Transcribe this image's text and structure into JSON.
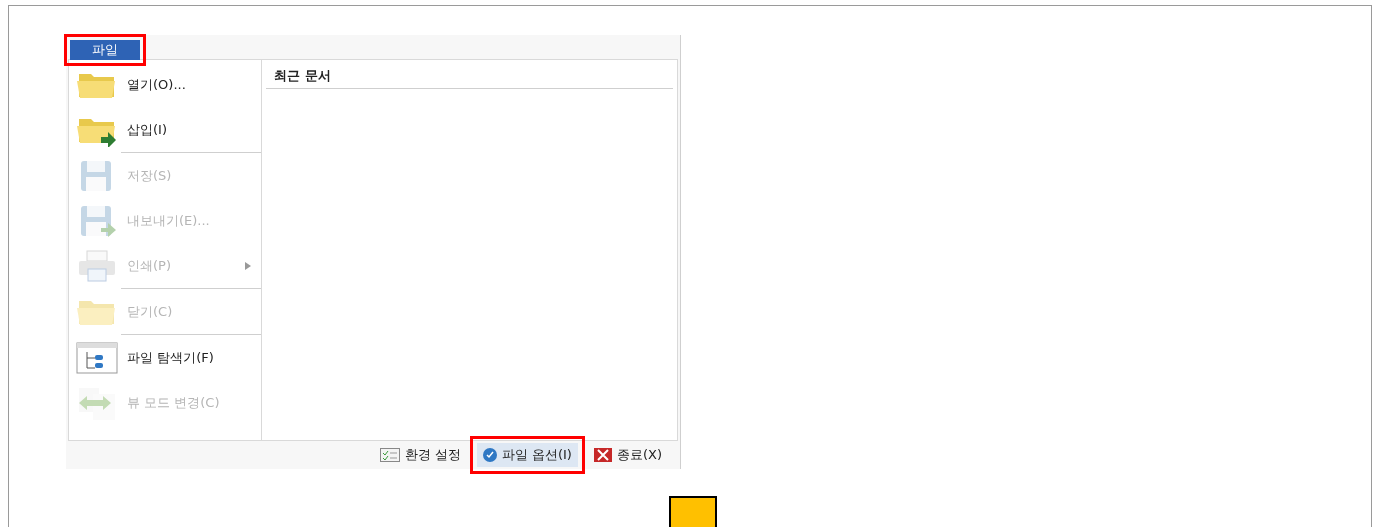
{
  "menu_tab": {
    "label": "파일",
    "highlighted": true
  },
  "menu_items": [
    {
      "label": "열기(O)...",
      "kind": "folder",
      "disabled": false,
      "separator_after": false,
      "submenu": false
    },
    {
      "label": "삽입(I)",
      "kind": "folder-insert",
      "disabled": false,
      "separator_after": true,
      "submenu": false
    },
    {
      "label": "저장(S)",
      "kind": "disk",
      "disabled": true,
      "separator_after": false,
      "submenu": false
    },
    {
      "label": "내보내기(E)...",
      "kind": "disk-export",
      "disabled": true,
      "separator_after": false,
      "submenu": false
    },
    {
      "label": "인쇄(P)",
      "kind": "printer",
      "disabled": true,
      "separator_after": true,
      "submenu": true
    },
    {
      "label": "닫기(C)",
      "kind": "folder-plain",
      "disabled": true,
      "separator_after": true,
      "submenu": false
    },
    {
      "label": "파일 탐색기(F)",
      "kind": "explorer",
      "disabled": false,
      "separator_after": false,
      "submenu": false
    },
    {
      "label": "뷰 모드 변경(C)",
      "kind": "swap",
      "disabled": true,
      "separator_after": false,
      "submenu": false
    }
  ],
  "recent_documents": {
    "title": "최근 문서"
  },
  "footer_buttons": [
    {
      "label": "환경 설정",
      "kind": "settings",
      "highlighted": false
    },
    {
      "label": "파일 옵션(I)",
      "kind": "check",
      "highlighted": true
    },
    {
      "label": "종료(X)",
      "kind": "exit",
      "highlighted": false
    }
  ]
}
